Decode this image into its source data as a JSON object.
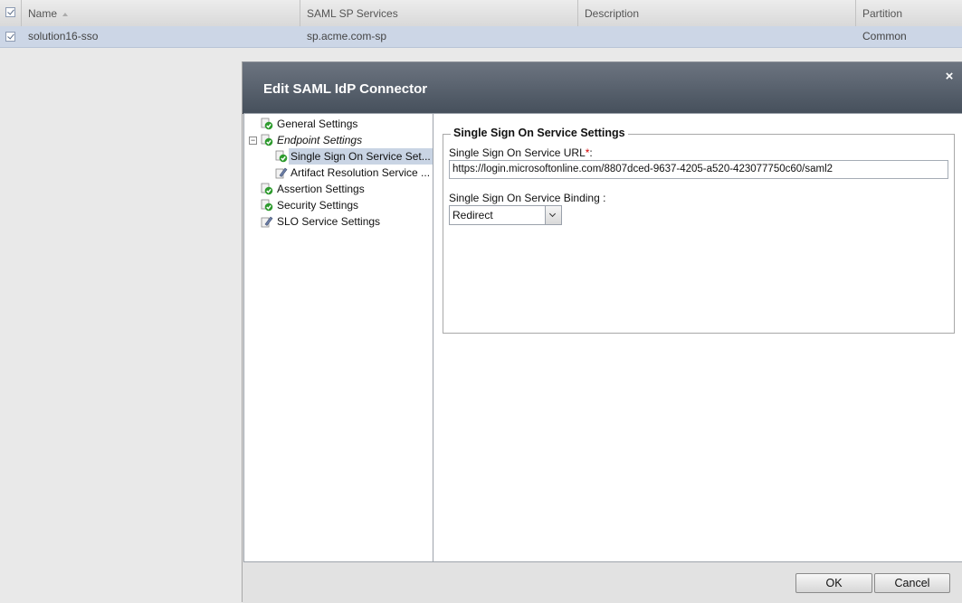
{
  "grid": {
    "columns": [
      "Name",
      "SAML SP Services",
      "Description",
      "Partition"
    ],
    "rows": [
      {
        "name": "solution16-sso",
        "sp_services": "sp.acme.com-sp",
        "description": "",
        "partition": "Common",
        "checked": true
      }
    ]
  },
  "dialog": {
    "title": "Edit SAML IdP Connector",
    "tree": [
      {
        "label": "General Settings",
        "status": "ok"
      },
      {
        "label": "Endpoint Settings",
        "status": "ok",
        "expanded": true
      },
      {
        "label": "Single Sign On Service Set...",
        "status": "ok",
        "selected": true
      },
      {
        "label": "Artifact Resolution Service ...",
        "status": "edit"
      },
      {
        "label": "Assertion Settings",
        "status": "ok"
      },
      {
        "label": "Security Settings",
        "status": "ok"
      },
      {
        "label": "SLO Service Settings",
        "status": "edit"
      }
    ],
    "section_title": "Single Sign On Service Settings",
    "url_label": "Single Sign On Service URL",
    "url_required_mark": "*",
    "url_colon": ":",
    "url_value": "https://login.microsoftonline.com/8807dced-9637-4205-a520-423077750c60/saml2",
    "binding_label": "Single Sign On Service Binding :",
    "binding_value": "Redirect",
    "ok_label": "OK",
    "cancel_label": "Cancel",
    "close_glyph": "×"
  },
  "colors": {
    "selected_row": "#ccd6e6",
    "title_bar": "#4b5561",
    "status_ok": "#2e9b2e"
  }
}
